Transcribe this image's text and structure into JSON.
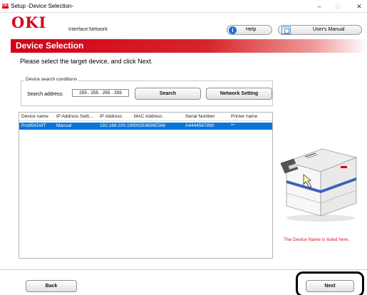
{
  "window": {
    "title": "Setup -Device Selection-",
    "app_icon_text": "OKI",
    "controls": {
      "minimize": "–",
      "maximize": "□",
      "close": "✕"
    }
  },
  "header": {
    "logo": "OKI",
    "interface_label": "Interface:Network",
    "help_label": "Help",
    "manual_label": "User's Manual"
  },
  "banner": {
    "title": "Device Selection"
  },
  "instruction": "Please select the target device, and click Next.",
  "search": {
    "legend": "Device search conditions",
    "address_label": "Search address:",
    "address_value": "255 . 255 . 255 . 255",
    "search_button": "Search",
    "network_button": "Network Setting"
  },
  "table": {
    "columns": [
      "Device name",
      "IP Address Setti...",
      "IP Address",
      "MAC Address",
      "Serial Number",
      "Printer name"
    ],
    "rows": [
      [
        "Pro9541WT",
        "Manual",
        "192.168.100.100",
        "00253656E566",
        "A4444567890",
        "**"
      ]
    ]
  },
  "side": {
    "caption": "The Device Name is listed here."
  },
  "footer": {
    "back_label": "Back",
    "next_label": "Next"
  },
  "colors": {
    "brand_red": "#d6001c",
    "selection_blue": "#0a75d6",
    "caption_red": "#e0101a"
  }
}
